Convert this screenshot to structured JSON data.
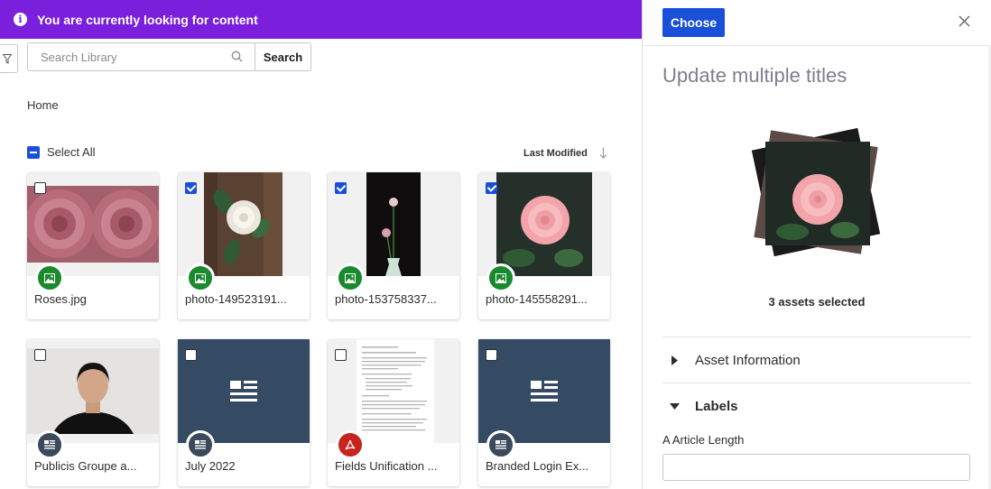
{
  "banner": {
    "text": "You are currently looking for content",
    "color": "#7a1fdc"
  },
  "search": {
    "placeholder": "Search Library",
    "value": "",
    "button_label": "Search"
  },
  "breadcrumb": {
    "home": "Home"
  },
  "select_all": {
    "label": "Select All",
    "state": "indeterminate"
  },
  "sort": {
    "label": "Last Modified",
    "direction": "descending"
  },
  "assets": [
    {
      "label": "Roses.jpg",
      "type": "image",
      "checked": false
    },
    {
      "label": "photo-149523191...",
      "type": "image",
      "checked": true
    },
    {
      "label": "photo-153758337...",
      "type": "image",
      "checked": true
    },
    {
      "label": "photo-145558291...",
      "type": "image",
      "checked": true
    },
    {
      "label": "Publicis Groupe a...",
      "type": "article",
      "checked": false
    },
    {
      "label": "July 2022",
      "type": "article",
      "checked": false
    },
    {
      "label": "Fields Unification ...",
      "type": "pdf",
      "checked": false
    },
    {
      "label": "Branded Login Ex...",
      "type": "article",
      "checked": false
    }
  ],
  "panel": {
    "choose_label": "Choose",
    "title": "Update multiple titles",
    "selected_count_text": "3 assets selected",
    "sections": [
      {
        "label": "Asset Information",
        "expanded": false
      },
      {
        "label": "Labels",
        "expanded": true
      }
    ],
    "field_label": "A Article Length",
    "field_value": ""
  },
  "colors": {
    "accent": "#1a4fd8",
    "image_badge": "#1a8a2e",
    "article_badge": "#3a4a5c",
    "pdf_badge": "#c8231d",
    "article_tile": "#354a63"
  }
}
